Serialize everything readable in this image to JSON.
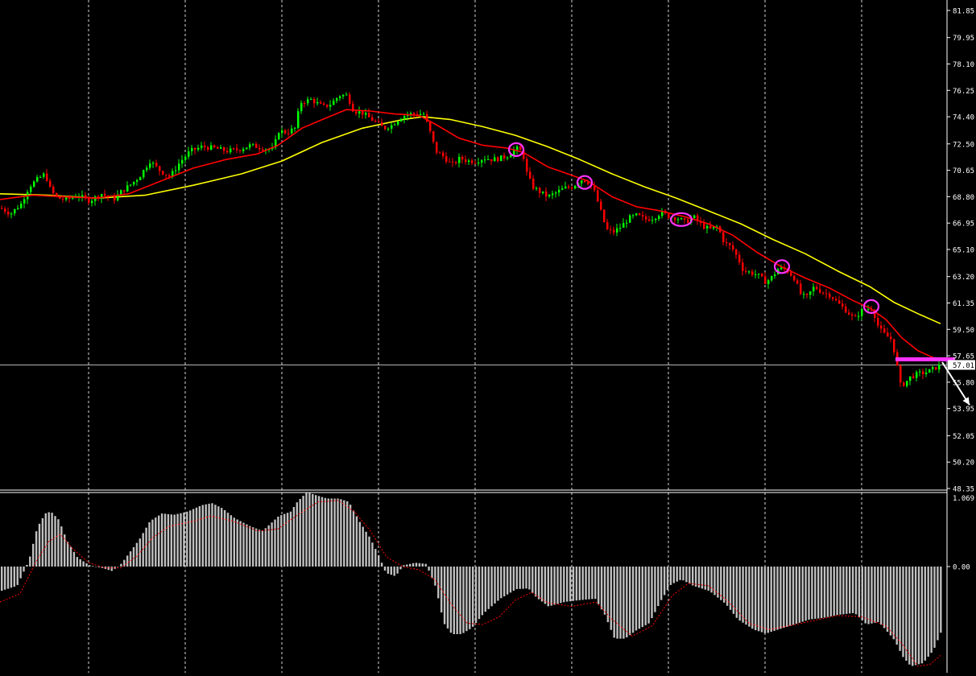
{
  "colors": {
    "background": "#000000",
    "grid": "#ffffff",
    "up_candle": "#00ff00",
    "down_candle": "#ff0000",
    "ema_fast": "#ff0000",
    "ema_slow": "#ffff00",
    "macd_hist": "#c0c0c0",
    "macd_signal": "#ff0000",
    "marker": "#ff33ff",
    "axis_text": "#ffffff",
    "price_label_bg": "#ffffff",
    "price_label_text": "#000000"
  },
  "chart_data": [
    {
      "type": "line",
      "subtype": "candlestick",
      "ylim": [
        48.35,
        81.85
      ],
      "y_ticks": [
        "81.85",
        "79.95",
        "78.10",
        "76.25",
        "74.40",
        "72.50",
        "70.65",
        "68.80",
        "66.95",
        "65.10",
        "63.20",
        "61.35",
        "59.50",
        "57.65",
        "55.80",
        "53.95",
        "52.05",
        "50.20",
        "48.35"
      ],
      "current_price": "57.01",
      "current_price_value": 57.01,
      "price_path": [
        [
          0,
          68.0
        ],
        [
          12,
          67.6
        ],
        [
          25,
          68.3
        ],
        [
          35,
          69.5
        ],
        [
          45,
          70.0
        ],
        [
          55,
          70.4
        ],
        [
          62,
          69.2
        ],
        [
          70,
          68.7
        ],
        [
          82,
          68.6
        ],
        [
          95,
          68.9
        ],
        [
          110,
          68.5
        ],
        [
          125,
          69.0
        ],
        [
          140,
          68.6
        ],
        [
          150,
          69.2
        ],
        [
          160,
          69.6
        ],
        [
          172,
          70.2
        ],
        [
          185,
          71.3
        ],
        [
          198,
          70.6
        ],
        [
          210,
          70.2
        ],
        [
          222,
          71.2
        ],
        [
          235,
          72.0
        ],
        [
          250,
          72.3
        ],
        [
          265,
          72.2
        ],
        [
          280,
          72.0
        ],
        [
          295,
          72.1
        ],
        [
          310,
          72.4
        ],
        [
          325,
          72.2
        ],
        [
          338,
          72.1
        ],
        [
          345,
          73.4
        ],
        [
          355,
          73.3
        ],
        [
          365,
          73.6
        ],
        [
          372,
          75.4
        ],
        [
          385,
          75.6
        ],
        [
          400,
          75.1
        ],
        [
          410,
          75.3
        ],
        [
          420,
          75.9
        ],
        [
          430,
          75.9
        ],
        [
          438,
          74.8
        ],
        [
          448,
          74.7
        ],
        [
          458,
          74.3
        ],
        [
          466,
          74.0
        ],
        [
          475,
          73.6
        ],
        [
          485,
          73.8
        ],
        [
          495,
          74.3
        ],
        [
          505,
          74.6
        ],
        [
          515,
          74.6
        ],
        [
          525,
          74.6
        ],
        [
          532,
          73.5
        ],
        [
          540,
          72.0
        ],
        [
          550,
          71.6
        ],
        [
          560,
          71.0
        ],
        [
          570,
          71.5
        ],
        [
          580,
          71.3
        ],
        [
          590,
          71.3
        ],
        [
          600,
          71.5
        ],
        [
          610,
          71.4
        ],
        [
          620,
          71.5
        ],
        [
          630,
          71.7
        ],
        [
          640,
          72.2
        ],
        [
          648,
          71.9
        ],
        [
          652,
          70.6
        ],
        [
          660,
          69.5
        ],
        [
          670,
          69.1
        ],
        [
          680,
          68.8
        ],
        [
          690,
          69.1
        ],
        [
          700,
          69.4
        ],
        [
          710,
          69.5
        ],
        [
          720,
          70.0
        ],
        [
          728,
          69.9
        ],
        [
          736,
          69.3
        ],
        [
          742,
          68.3
        ],
        [
          748,
          67.2
        ],
        [
          752,
          66.5
        ],
        [
          760,
          66.3
        ],
        [
          770,
          66.7
        ],
        [
          780,
          67.3
        ],
        [
          790,
          67.5
        ],
        [
          800,
          67.2
        ],
        [
          810,
          67.3
        ],
        [
          820,
          67.7
        ],
        [
          830,
          67.4
        ],
        [
          840,
          67.3
        ],
        [
          850,
          67.0
        ],
        [
          860,
          67.4
        ],
        [
          870,
          66.8
        ],
        [
          880,
          66.5
        ],
        [
          890,
          66.7
        ],
        [
          898,
          65.6
        ],
        [
          908,
          65.2
        ],
        [
          916,
          64.4
        ],
        [
          922,
          63.6
        ],
        [
          930,
          63.5
        ],
        [
          940,
          63.3
        ],
        [
          950,
          62.8
        ],
        [
          958,
          63.2
        ],
        [
          966,
          63.8
        ],
        [
          975,
          63.7
        ],
        [
          985,
          63.1
        ],
        [
          993,
          62.0
        ],
        [
          1000,
          61.7
        ],
        [
          1010,
          62.5
        ],
        [
          1020,
          62.1
        ],
        [
          1030,
          61.9
        ],
        [
          1040,
          61.3
        ],
        [
          1050,
          60.8
        ],
        [
          1060,
          60.2
        ],
        [
          1068,
          60.8
        ],
        [
          1075,
          60.9
        ],
        [
          1082,
          61.0
        ],
        [
          1090,
          59.6
        ],
        [
          1098,
          59.1
        ],
        [
          1106,
          58.8
        ],
        [
          1112,
          57.3
        ],
        [
          1116,
          55.6
        ],
        [
          1122,
          55.7
        ],
        [
          1130,
          56.2
        ],
        [
          1140,
          56.4
        ],
        [
          1150,
          56.5
        ],
        [
          1160,
          56.8
        ],
        [
          1168,
          57.01
        ]
      ],
      "ema_fast": [
        [
          0,
          68.6
        ],
        [
          40,
          68.9
        ],
        [
          80,
          68.8
        ],
        [
          120,
          68.7
        ],
        [
          160,
          69.0
        ],
        [
          200,
          69.9
        ],
        [
          240,
          70.8
        ],
        [
          280,
          71.4
        ],
        [
          320,
          71.8
        ],
        [
          345,
          72.4
        ],
        [
          375,
          73.6
        ],
        [
          400,
          74.2
        ],
        [
          430,
          74.9
        ],
        [
          460,
          74.8
        ],
        [
          490,
          74.6
        ],
        [
          520,
          74.5
        ],
        [
          540,
          73.9
        ],
        [
          570,
          72.9
        ],
        [
          600,
          72.4
        ],
        [
          630,
          72.2
        ],
        [
          650,
          71.9
        ],
        [
          680,
          70.9
        ],
        [
          710,
          70.3
        ],
        [
          730,
          69.9
        ],
        [
          760,
          68.8
        ],
        [
          790,
          68.1
        ],
        [
          820,
          67.8
        ],
        [
          850,
          67.4
        ],
        [
          880,
          66.9
        ],
        [
          910,
          66.1
        ],
        [
          940,
          64.9
        ],
        [
          970,
          63.9
        ],
        [
          1000,
          63.1
        ],
        [
          1030,
          62.4
        ],
        [
          1060,
          61.5
        ],
        [
          1080,
          61.0
        ],
        [
          1100,
          60.2
        ],
        [
          1120,
          58.9
        ],
        [
          1140,
          58.0
        ],
        [
          1160,
          57.5
        ],
        [
          1170,
          57.4
        ]
      ],
      "ema_slow": [
        [
          0,
          69.0
        ],
        [
          60,
          68.9
        ],
        [
          120,
          68.7
        ],
        [
          180,
          68.9
        ],
        [
          240,
          69.6
        ],
        [
          300,
          70.4
        ],
        [
          350,
          71.3
        ],
        [
          400,
          72.6
        ],
        [
          450,
          73.6
        ],
        [
          500,
          74.2
        ],
        [
          525,
          74.4
        ],
        [
          560,
          74.2
        ],
        [
          600,
          73.7
        ],
        [
          640,
          73.1
        ],
        [
          680,
          72.3
        ],
        [
          720,
          71.4
        ],
        [
          760,
          70.4
        ],
        [
          800,
          69.5
        ],
        [
          840,
          68.7
        ],
        [
          880,
          67.8
        ],
        [
          920,
          66.9
        ],
        [
          960,
          65.8
        ],
        [
          1000,
          64.8
        ],
        [
          1040,
          63.6
        ],
        [
          1080,
          62.5
        ],
        [
          1110,
          61.4
        ],
        [
          1140,
          60.6
        ],
        [
          1168,
          59.9
        ]
      ],
      "markers": [
        {
          "shape": "ellipse",
          "x": 641,
          "y": 72.1
        },
        {
          "shape": "ellipse",
          "x": 726,
          "y": 69.8
        },
        {
          "shape": "ellipse",
          "x": 846,
          "y": 67.2
        },
        {
          "shape": "ellipse",
          "x": 971,
          "y": 63.9
        },
        {
          "shape": "ellipse",
          "x": 1082,
          "y": 61.1
        }
      ],
      "resistance_line": {
        "x1": 1112,
        "x2": 1186,
        "y": 57.4
      },
      "arrow": {
        "x1": 1170,
        "y1": 57.2,
        "x2": 1204,
        "y2": 54.2
      }
    },
    {
      "type": "bar",
      "subtype": "macd",
      "y_ticks": [
        "1.069",
        "0.00"
      ],
      "ylim": [
        -1.6,
        1.069
      ],
      "histogram_path": [
        [
          0,
          -0.38
        ],
        [
          20,
          -0.3
        ],
        [
          35,
          0.1
        ],
        [
          45,
          0.6
        ],
        [
          55,
          0.82
        ],
        [
          62,
          0.85
        ],
        [
          72,
          0.72
        ],
        [
          82,
          0.4
        ],
        [
          95,
          0.14
        ],
        [
          110,
          0.02
        ],
        [
          125,
          -0.02
        ],
        [
          138,
          -0.07
        ],
        [
          150,
          0.05
        ],
        [
          160,
          0.22
        ],
        [
          172,
          0.42
        ],
        [
          185,
          0.7
        ],
        [
          200,
          0.82
        ],
        [
          215,
          0.8
        ],
        [
          232,
          0.85
        ],
        [
          250,
          0.95
        ],
        [
          262,
          0.98
        ],
        [
          275,
          0.9
        ],
        [
          290,
          0.75
        ],
        [
          310,
          0.62
        ],
        [
          325,
          0.55
        ],
        [
          345,
          0.78
        ],
        [
          360,
          0.85
        ],
        [
          368,
          1.0
        ],
        [
          380,
          1.15
        ],
        [
          392,
          1.1
        ],
        [
          405,
          1.05
        ],
        [
          420,
          1.05
        ],
        [
          432,
          1.0
        ],
        [
          445,
          0.7
        ],
        [
          458,
          0.45
        ],
        [
          470,
          0.15
        ],
        [
          478,
          -0.1
        ],
        [
          490,
          -0.15
        ],
        [
          500,
          0.02
        ],
        [
          515,
          0.06
        ],
        [
          528,
          0.04
        ],
        [
          540,
          -0.32
        ],
        [
          550,
          -0.88
        ],
        [
          560,
          -1.05
        ],
        [
          572,
          -1.05
        ],
        [
          585,
          -0.95
        ],
        [
          600,
          -0.72
        ],
        [
          620,
          -0.5
        ],
        [
          640,
          -0.35
        ],
        [
          655,
          -0.34
        ],
        [
          665,
          -0.48
        ],
        [
          680,
          -0.62
        ],
        [
          700,
          -0.55
        ],
        [
          720,
          -0.52
        ],
        [
          738,
          -0.5
        ],
        [
          750,
          -0.75
        ],
        [
          762,
          -1.12
        ],
        [
          775,
          -1.12
        ],
        [
          788,
          -1.0
        ],
        [
          805,
          -0.88
        ],
        [
          820,
          -0.52
        ],
        [
          832,
          -0.28
        ],
        [
          845,
          -0.2
        ],
        [
          860,
          -0.3
        ],
        [
          880,
          -0.38
        ],
        [
          900,
          -0.58
        ],
        [
          915,
          -0.82
        ],
        [
          935,
          -0.98
        ],
        [
          950,
          -1.04
        ],
        [
          965,
          -0.98
        ],
        [
          985,
          -0.9
        ],
        [
          1005,
          -0.82
        ],
        [
          1020,
          -0.8
        ],
        [
          1040,
          -0.75
        ],
        [
          1060,
          -0.72
        ],
        [
          1075,
          -0.9
        ],
        [
          1090,
          -0.86
        ],
        [
          1100,
          -1.0
        ],
        [
          1110,
          -1.15
        ],
        [
          1120,
          -1.4
        ],
        [
          1130,
          -1.55
        ],
        [
          1145,
          -1.5
        ],
        [
          1158,
          -1.3
        ],
        [
          1168,
          -1.0
        ]
      ],
      "signal_path": [
        [
          0,
          -0.55
        ],
        [
          25,
          -0.42
        ],
        [
          45,
          0.08
        ],
        [
          60,
          0.38
        ],
        [
          75,
          0.5
        ],
        [
          90,
          0.28
        ],
        [
          110,
          0.06
        ],
        [
          130,
          -0.02
        ],
        [
          150,
          -0.02
        ],
        [
          170,
          0.16
        ],
        [
          190,
          0.45
        ],
        [
          210,
          0.62
        ],
        [
          240,
          0.7
        ],
        [
          262,
          0.78
        ],
        [
          290,
          0.7
        ],
        [
          320,
          0.55
        ],
        [
          345,
          0.58
        ],
        [
          370,
          0.8
        ],
        [
          395,
          1.0
        ],
        [
          420,
          1.02
        ],
        [
          440,
          0.85
        ],
        [
          460,
          0.55
        ],
        [
          480,
          0.15
        ],
        [
          500,
          0.0
        ],
        [
          520,
          -0.05
        ],
        [
          540,
          -0.2
        ],
        [
          560,
          -0.58
        ],
        [
          580,
          -0.88
        ],
        [
          600,
          -0.9
        ],
        [
          620,
          -0.78
        ],
        [
          640,
          -0.52
        ],
        [
          660,
          -0.4
        ],
        [
          680,
          -0.56
        ],
        [
          710,
          -0.62
        ],
        [
          740,
          -0.55
        ],
        [
          760,
          -0.82
        ],
        [
          785,
          -1.08
        ],
        [
          810,
          -0.92
        ],
        [
          835,
          -0.45
        ],
        [
          855,
          -0.26
        ],
        [
          880,
          -0.3
        ],
        [
          905,
          -0.55
        ],
        [
          930,
          -0.88
        ],
        [
          955,
          -0.98
        ],
        [
          980,
          -0.92
        ],
        [
          1010,
          -0.84
        ],
        [
          1040,
          -0.76
        ],
        [
          1070,
          -0.78
        ],
        [
          1100,
          -0.92
        ],
        [
          1120,
          -1.2
        ],
        [
          1140,
          -1.55
        ],
        [
          1155,
          -1.52
        ],
        [
          1168,
          -1.38
        ]
      ]
    }
  ]
}
